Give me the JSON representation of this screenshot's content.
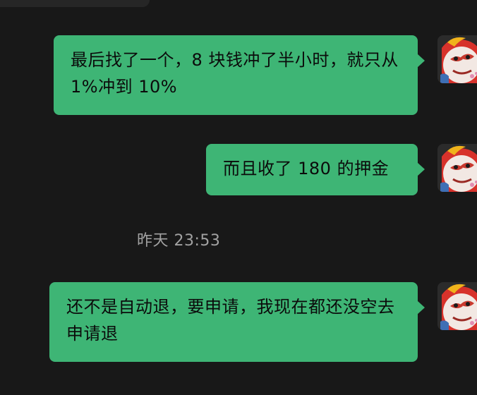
{
  "messages": [
    {
      "sender": "self",
      "text": "最后找了一个，8 块钱冲了半小时，就只从 1%冲到 10%"
    },
    {
      "sender": "self",
      "text": "而且收了 180 的押金"
    },
    {
      "sender": "self",
      "text": "还不是自动退，要申请，我现在都还没空去申请退"
    }
  ],
  "timestamp": "昨天 23:53",
  "avatar": {
    "icon": "monkey-king-mask-avatar"
  },
  "colors": {
    "background": "#181818",
    "bubble": "#3eb575",
    "timestamp_text": "#a2a2a2"
  }
}
